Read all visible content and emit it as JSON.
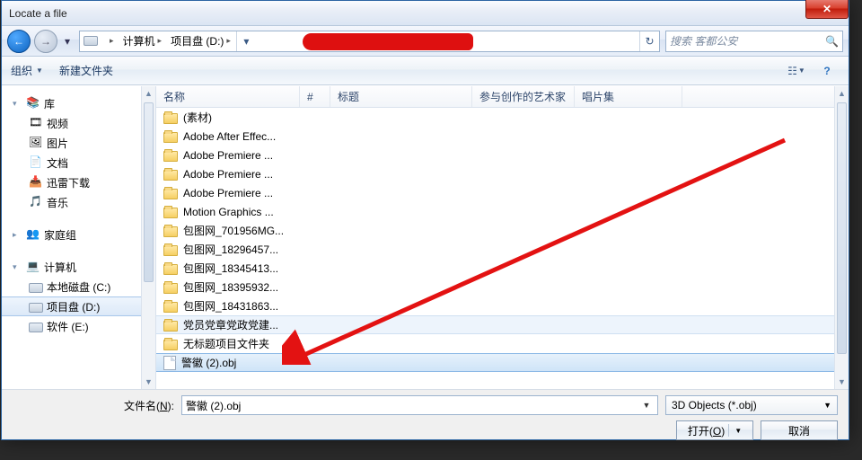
{
  "window": {
    "title": "Locate a file"
  },
  "nav": {
    "breadcrumbs": [
      "计算机",
      "项目盘 (D:)"
    ],
    "search_placeholder": "搜索 客都公安"
  },
  "toolbar": {
    "organize": "组织",
    "newfolder": "新建文件夹"
  },
  "navpane": {
    "library": {
      "label": "库",
      "items": [
        "视频",
        "图片",
        "文档",
        "迅雷下载",
        "音乐"
      ]
    },
    "homegroup": "家庭组",
    "computer": {
      "label": "计算机",
      "drives": [
        "本地磁盘 (C:)",
        "项目盘 (D:)",
        "软件 (E:)"
      ],
      "selected": 1
    }
  },
  "columns": {
    "name": "名称",
    "num": "#",
    "title": "标题",
    "artists": "参与创作的艺术家",
    "album": "唱片集"
  },
  "files": [
    {
      "name": "(素材)",
      "type": "folder"
    },
    {
      "name": "Adobe After Effec...",
      "type": "folder"
    },
    {
      "name": "Adobe Premiere ...",
      "type": "folder"
    },
    {
      "name": "Adobe Premiere ...",
      "type": "folder"
    },
    {
      "name": "Adobe Premiere ...",
      "type": "folder"
    },
    {
      "name": "Motion Graphics ...",
      "type": "folder"
    },
    {
      "name": "包图网_701956MG...",
      "type": "folder"
    },
    {
      "name": "包图网_18296457...",
      "type": "folder"
    },
    {
      "name": "包图网_18345413...",
      "type": "folder"
    },
    {
      "name": "包图网_18395932...",
      "type": "folder"
    },
    {
      "name": "包图网_18431863...",
      "type": "folder"
    },
    {
      "name": "党员党章党政党建...",
      "type": "folder",
      "hover": true
    },
    {
      "name": "无标题项目文件夹",
      "type": "folder"
    },
    {
      "name": "警徽 (2).obj",
      "type": "file",
      "selected": true
    }
  ],
  "footer": {
    "filename_label": "文件名(N):",
    "filename_value": "警徽 (2).obj",
    "filter": "3D Objects (*.obj)",
    "open": "打开(O)",
    "cancel": "取消"
  }
}
